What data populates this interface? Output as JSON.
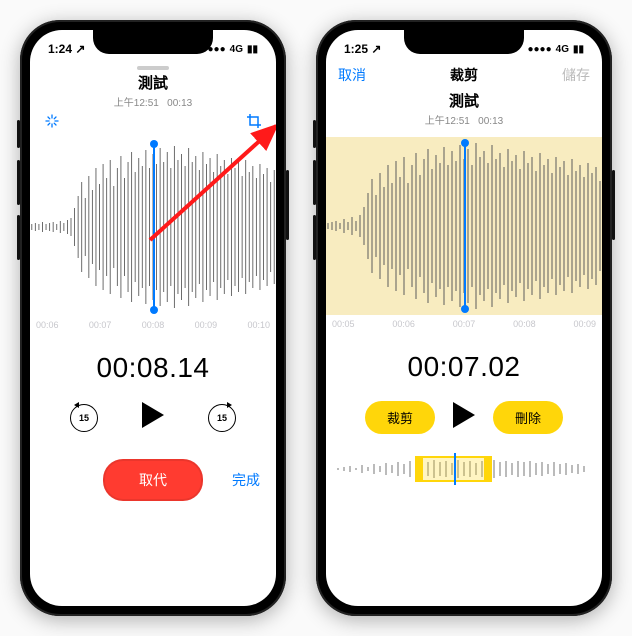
{
  "left": {
    "status": {
      "time": "1:24",
      "loc_icon": "location-arrow",
      "signal": "●●●●",
      "net": "4G",
      "batt": "▮▮"
    },
    "title": "測試",
    "subtitle_time": "上午12:51",
    "subtitle_dur": "00:13",
    "tools": {
      "enhance_icon": "sparkle-icon",
      "crop_icon": "crop-icon"
    },
    "ticks": [
      "00:06",
      "00:07",
      "00:08",
      "00:09",
      "00:10"
    ],
    "timecode": "00:08.14",
    "skip_back": "15",
    "skip_fwd": "15",
    "replace_btn": "取代",
    "done_link": "完成"
  },
  "right": {
    "status": {
      "time": "1:25",
      "loc_icon": "location-arrow",
      "signal": "●●●●",
      "net": "4G",
      "batt": "▮▮"
    },
    "cancel_link": "取消",
    "header": "裁剪",
    "save_link": "儲存",
    "title": "測試",
    "subtitle_time": "上午12:51",
    "subtitle_dur": "00:13",
    "ticks": [
      "00:05",
      "00:06",
      "00:07",
      "00:08",
      "00:09"
    ],
    "timecode": "00:07.02",
    "trim_btn": "裁剪",
    "delete_btn": "刪除"
  },
  "annotation": {
    "desc": "red-arrow pointing to crop icon"
  }
}
